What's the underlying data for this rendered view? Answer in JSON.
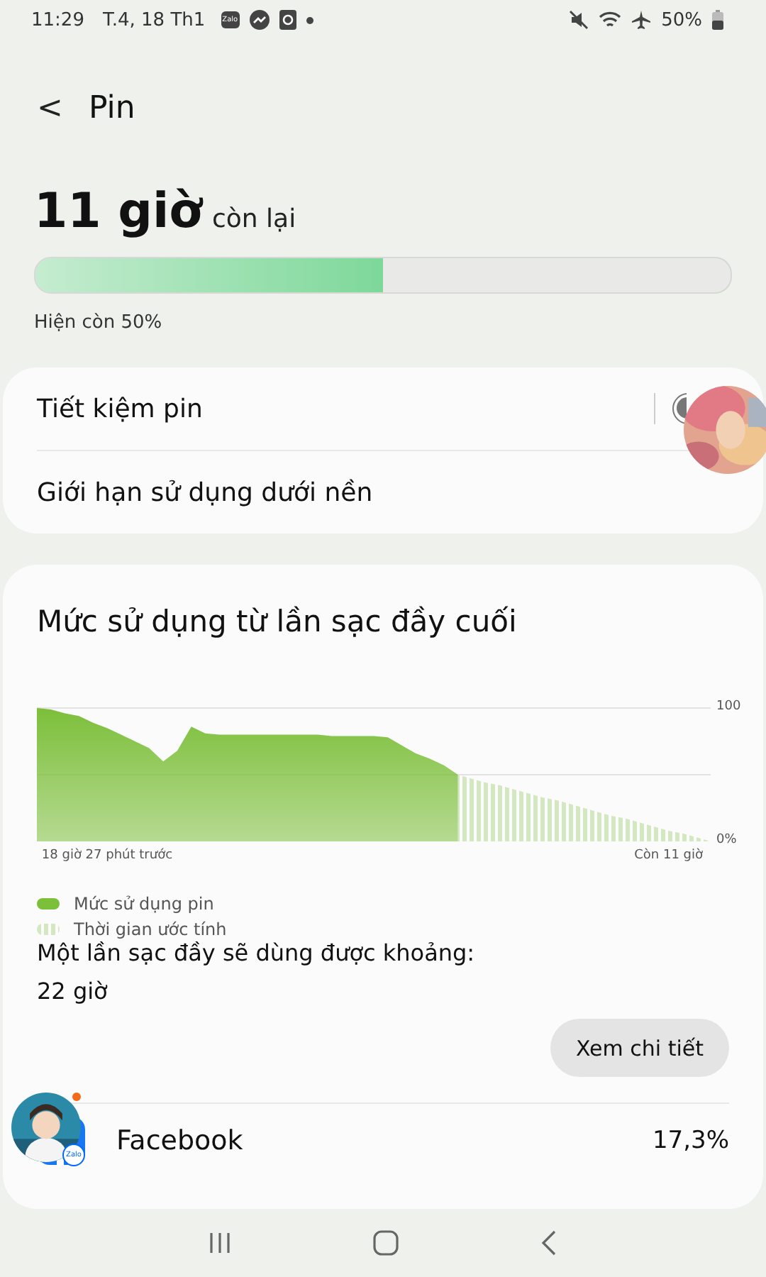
{
  "status_bar": {
    "time": "11:29",
    "date": "T.4, 18 Th1",
    "notification_label": "Zalo",
    "battery": "50%"
  },
  "header": {
    "back": "<",
    "title": "Pin"
  },
  "summary": {
    "hours": "11 giờ",
    "suffix": "còn lại",
    "level": 0.5,
    "remaining": "Hiện còn 50%"
  },
  "settings": [
    {
      "label": "Tiết kiệm pin",
      "kind": "toggle",
      "on": false
    },
    {
      "label": "Giới hạn sử dụng dưới nền",
      "kind": "link"
    }
  ],
  "usage": {
    "title": "Mức sử dụng từ lần sạc đầy cuối",
    "chart_data": {
      "type": "area",
      "categories": [
        null,
        null,
        null,
        null,
        null,
        "18 giờ 27 phút trước",
        null,
        null,
        null,
        null,
        null,
        null,
        null,
        null,
        null,
        null,
        null,
        null,
        null,
        null,
        null,
        null,
        null,
        null,
        null,
        null,
        null,
        null,
        null,
        null,
        null,
        null,
        null,
        null,
        null,
        null,
        null,
        null,
        null,
        null,
        null,
        null,
        null,
        null,
        null,
        "Còn 11 giờ",
        null,
        null,
        null
      ],
      "series": [
        {
          "name": "Mức sử dụng pin",
          "color": "#7cbf3a",
          "values": [
            100,
            99,
            96,
            94,
            89,
            85,
            80,
            75,
            70,
            60,
            68,
            86,
            81,
            80,
            80,
            80,
            80,
            80,
            80,
            80,
            80,
            79,
            79,
            79,
            79,
            78,
            72,
            66,
            62,
            57,
            50,
            null,
            null,
            null,
            null,
            null,
            null,
            null,
            null,
            null,
            null,
            null,
            null,
            null,
            null,
            null,
            null,
            null,
            null
          ]
        },
        {
          "name": "Thời gian ước tính",
          "color": "#d3e8c0",
          "values": [
            null,
            null,
            null,
            null,
            null,
            null,
            null,
            null,
            null,
            null,
            null,
            null,
            null,
            null,
            null,
            null,
            null,
            null,
            null,
            null,
            null,
            null,
            null,
            null,
            null,
            null,
            null,
            null,
            null,
            null,
            50,
            47,
            44,
            42,
            39,
            36,
            33,
            31,
            28,
            25,
            22,
            19,
            17,
            14,
            11,
            8,
            6,
            3,
            0
          ]
        }
      ],
      "legend": true,
      "ref_lines": [
        {
          "axis": "y",
          "value": 50
        }
      ],
      "ylim": [
        0,
        100
      ],
      "yticks": [
        {
          "value": 0,
          "label": "0%"
        },
        {
          "value": 100,
          "label": "100"
        }
      ]
    },
    "full_charge_text": "Một lần sạc đầy sẽ dùng được khoảng:",
    "full_charge_value": "22 giờ",
    "details_button": "Xem chi tiết",
    "apps": [
      {
        "name": "Facebook",
        "percent": "17,3%"
      }
    ]
  },
  "chat_heads": [
    {
      "kind": "picture"
    },
    {
      "kind": "picture",
      "badge": "Zalo"
    }
  ]
}
